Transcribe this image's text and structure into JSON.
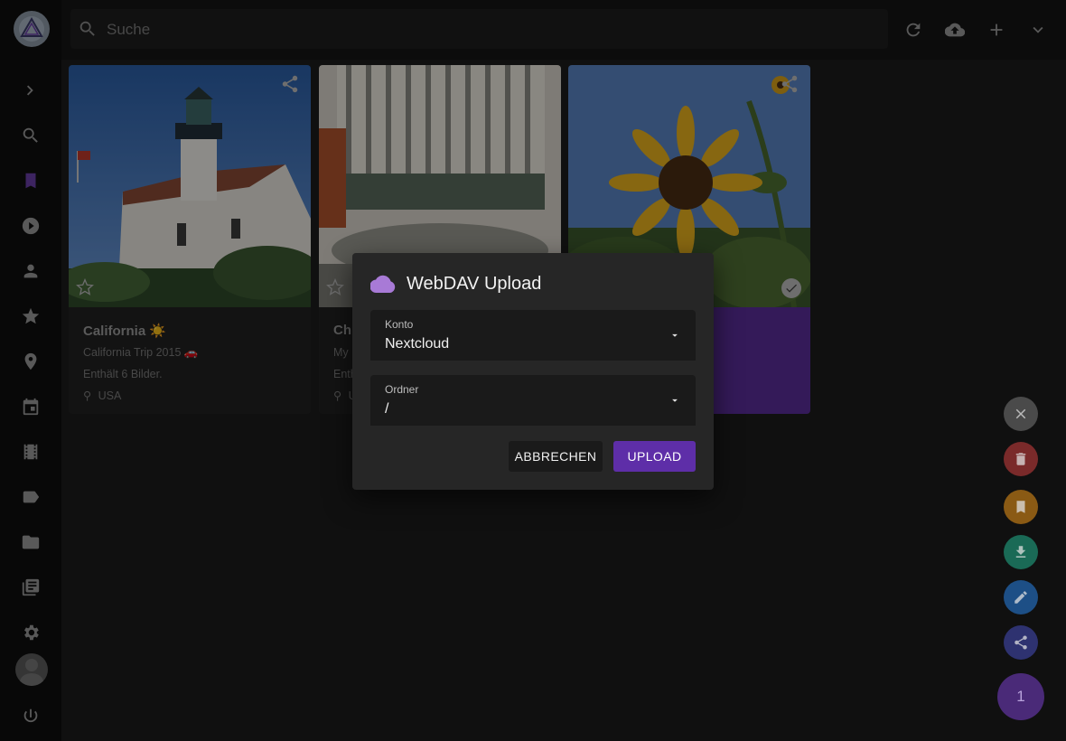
{
  "search": {
    "placeholder": "Suche"
  },
  "sidebar": {
    "items": [
      {
        "icon": "chevron-right-icon"
      },
      {
        "icon": "search-icon"
      },
      {
        "icon": "bookmark-icon"
      },
      {
        "icon": "play-icon"
      },
      {
        "icon": "person-icon"
      },
      {
        "icon": "star-icon"
      },
      {
        "icon": "location-icon"
      },
      {
        "icon": "calendar-icon"
      },
      {
        "icon": "film-icon"
      },
      {
        "icon": "label-icon"
      },
      {
        "icon": "folder-icon"
      },
      {
        "icon": "library-icon"
      },
      {
        "icon": "settings-icon"
      },
      {
        "icon": "power-icon"
      }
    ]
  },
  "toolbar": {
    "icons": [
      "refresh-icon",
      "cloud-upload-icon",
      "add-icon",
      "chevron-down-icon"
    ]
  },
  "cards": [
    {
      "title": "California ☀️",
      "subtitle": "California Trip 2015 🚗",
      "count_text": "Enthält 6 Bilder.",
      "location": "USA"
    },
    {
      "title": "Chi",
      "subtitle": "My",
      "count_text": "Enth",
      "location": "U"
    }
  ],
  "fab": {
    "count": "1"
  },
  "dialog": {
    "title": "WebDAV Upload",
    "account_label": "Konto",
    "account_value": "Nextcloud",
    "folder_label": "Ordner",
    "folder_value": "/",
    "cancel_label": "ABBRECHEN",
    "upload_label": "UPLOAD"
  },
  "colors": {
    "accent": "#5e2ea8",
    "cloud": "#a87ad6",
    "selected_card": "#5a2d9a"
  }
}
